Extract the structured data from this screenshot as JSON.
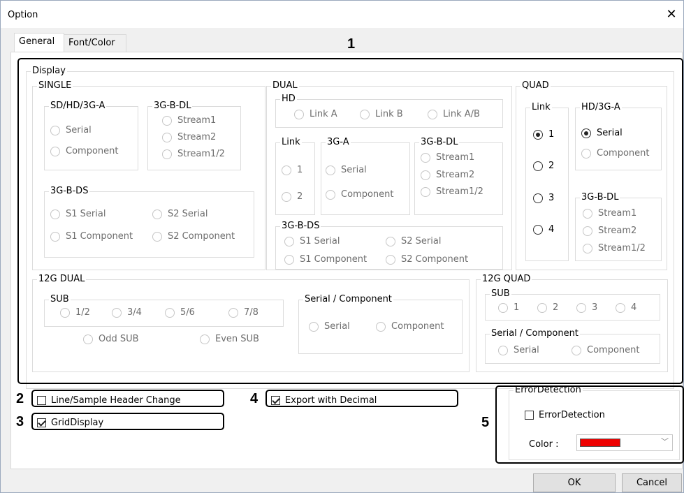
{
  "window": {
    "title": "Option"
  },
  "tabs": [
    {
      "label": "General"
    },
    {
      "label": "Font/Color"
    }
  ],
  "callout_numbers": {
    "n1": "1",
    "n2": "2",
    "n3": "3",
    "n4": "4",
    "n5": "5"
  },
  "display": {
    "label": "Display",
    "single": {
      "label": "SINGLE",
      "sdhd": {
        "label": "SD/HD/3G-A",
        "serial": "Serial",
        "component": "Component"
      },
      "bdl": {
        "label": "3G-B-DL",
        "s1": "Stream1",
        "s2": "Stream2",
        "s12": "Stream1/2"
      },
      "bds": {
        "label": "3G-B-DS",
        "s1serial": "S1 Serial",
        "s2serial": "S2 Serial",
        "s1comp": "S1 Component",
        "s2comp": "S2 Component"
      }
    },
    "dual": {
      "label": "DUAL",
      "hd": {
        "label": "HD",
        "a": "Link A",
        "b": "Link B",
        "ab": "Link A/B"
      },
      "link": {
        "label": "Link",
        "l1": "1",
        "l2": "2"
      },
      "ga": {
        "label": "3G-A",
        "serial": "Serial",
        "component": "Component"
      },
      "bdl": {
        "label": "3G-B-DL",
        "s1": "Stream1",
        "s2": "Stream2",
        "s12": "Stream1/2"
      },
      "bds": {
        "label": "3G-B-DS",
        "s1serial": "S1 Serial",
        "s2serial": "S2 Serial",
        "s1comp": "S1 Component",
        "s2comp": "S2 Component"
      }
    },
    "quad": {
      "label": "QUAD",
      "link": {
        "label": "Link",
        "l1": "1",
        "l2": "2",
        "l3": "3",
        "l4": "4",
        "selected": "1"
      },
      "hd3ga": {
        "label": "HD/3G-A",
        "serial": "Serial",
        "component": "Component",
        "selected": "Serial"
      },
      "bdl": {
        "label": "3G-B-DL",
        "s1": "Stream1",
        "s2": "Stream2",
        "s12": "Stream1/2"
      }
    },
    "g12dual": {
      "label": "12G DUAL",
      "sub": {
        "label": "SUB",
        "o1": "1/2",
        "o2": "3/4",
        "o3": "5/6",
        "o4": "7/8",
        "odd": "Odd SUB",
        "even": "Even SUB"
      },
      "sc": {
        "label": "Serial / Component",
        "serial": "Serial",
        "component": "Component"
      }
    },
    "g12quad": {
      "label": "12G QUAD",
      "sub": {
        "label": "SUB",
        "o1": "1",
        "o2": "2",
        "o3": "3",
        "o4": "4"
      },
      "sc": {
        "label": "Serial / Component",
        "serial": "Serial",
        "component": "Component"
      }
    }
  },
  "options": {
    "line_sample": {
      "label": "Line/Sample Header Change",
      "checked": false
    },
    "grid": {
      "label": "GridDisplay",
      "checked": true
    },
    "export_decimal": {
      "label": "Export with Decimal",
      "checked": true
    }
  },
  "error_detection": {
    "group_label": "ErrorDetection",
    "checkbox_label": "ErrorDetection",
    "checked": false,
    "color_label": "Color :",
    "color_value": "#ee0000"
  },
  "buttons": {
    "ok": "OK",
    "cancel": "Cancel"
  }
}
